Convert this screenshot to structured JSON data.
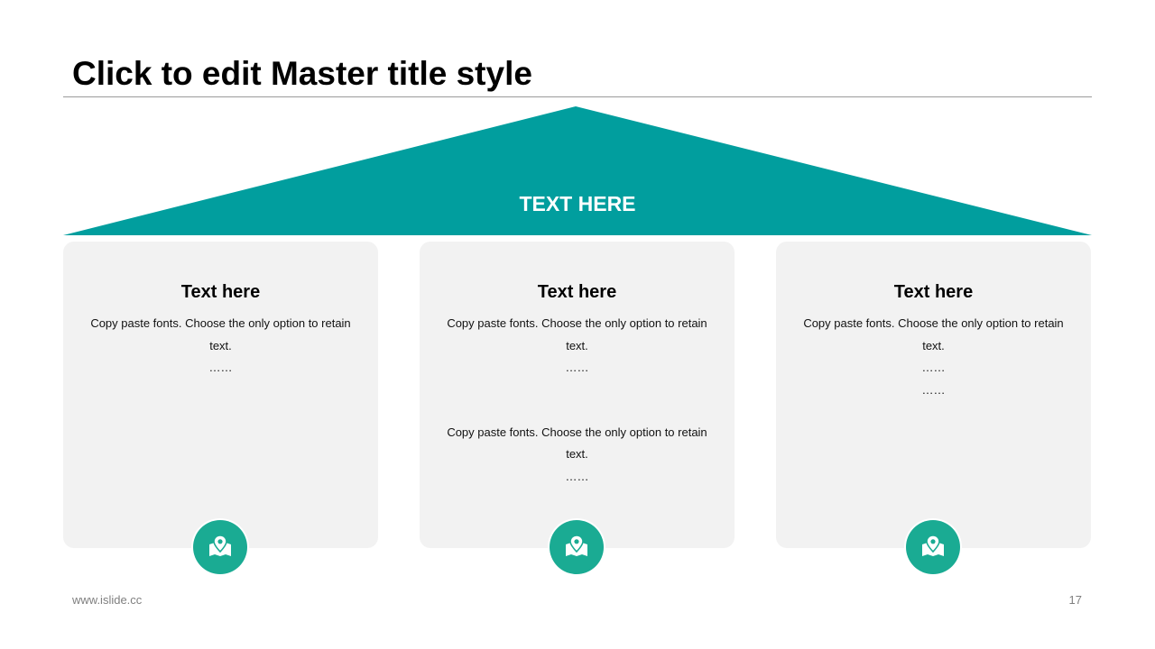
{
  "slide": {
    "title": "Click to edit Master title style",
    "roof_label": "TEXT HERE",
    "footer_url": "www.islide.cc",
    "page_number": "17"
  },
  "colors": {
    "roof": "#019e9e",
    "badge": "#1aab93",
    "card": "#f2f2f2"
  },
  "cards": [
    {
      "title": "Text here",
      "line1": "Copy paste fonts. Choose the only option to retain",
      "line2": "text.",
      "line3": "……",
      "icon": "map-pin-icon"
    },
    {
      "title": "Text here",
      "line1": "Copy paste fonts. Choose the only option to retain",
      "line2": "text.",
      "line3": "……",
      "line4": "Copy paste fonts. Choose the only option to retain",
      "line5": "text.",
      "line6": "……",
      "icon": "map-pin-icon"
    },
    {
      "title": "Text here",
      "line1": "Copy paste fonts. Choose the only option to retain",
      "line2": "text.",
      "line3": "……",
      "line4": "……",
      "icon": "map-pin-icon"
    }
  ]
}
